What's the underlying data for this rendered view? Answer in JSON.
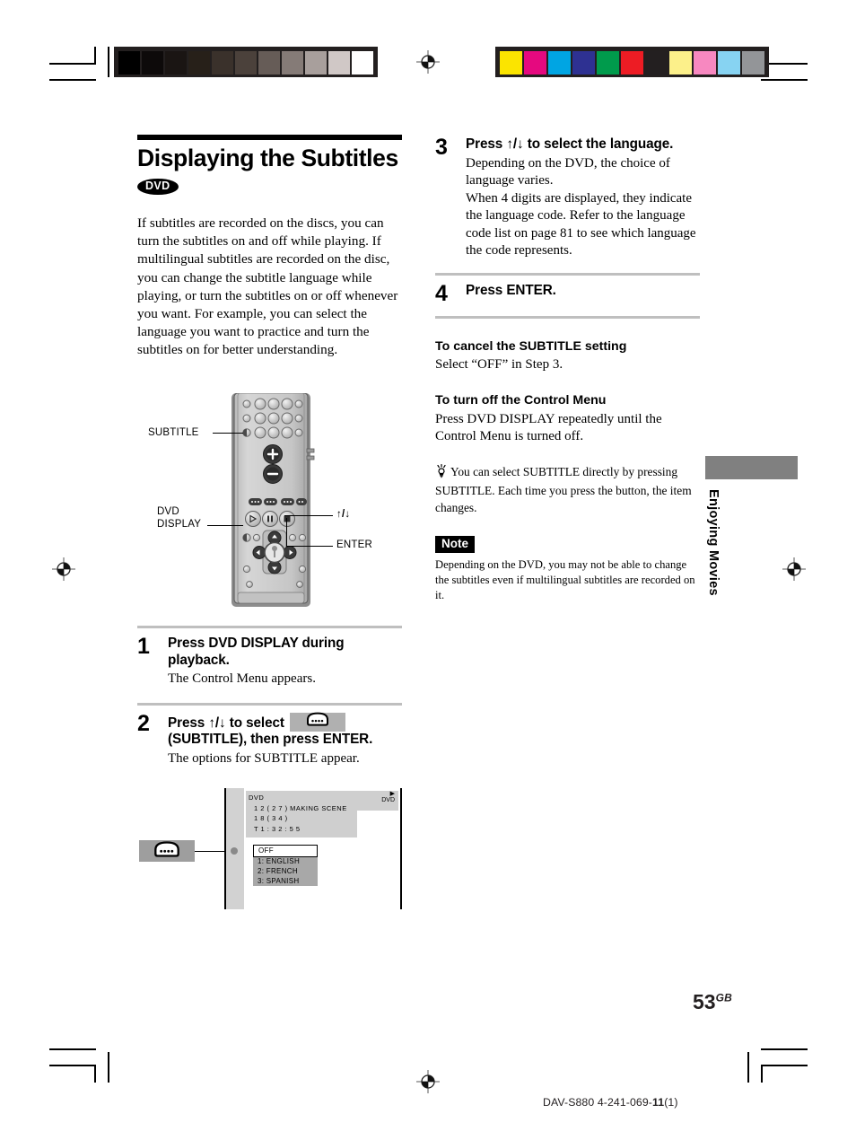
{
  "page": {
    "number": "53",
    "number_suffix": "GB",
    "model_line_prefix": "DAV-S880 4-241-069-",
    "model_line_bold": "11",
    "model_line_suffix": "(1)",
    "thumb_tab_label": "Enjoying Movies"
  },
  "colorbars": {
    "left_name": "grayscale-calibration-bar",
    "left_swatches": [
      "#000000",
      "#0d0a0a",
      "#1a1513",
      "#272019",
      "#3a312b",
      "#4b413b",
      "#665c57",
      "#857b77",
      "#a89f9c",
      "#d0c8c6",
      "#ffffff"
    ],
    "right_name": "color-calibration-bar",
    "right_swatches": [
      "#fbe400",
      "#e5097f",
      "#00a5e3",
      "#2e3192",
      "#009b4c",
      "#ed1c24",
      "#231f20",
      "#fcf08a",
      "#f788c0",
      "#87d3f2",
      "#939598"
    ]
  },
  "left_column": {
    "title": "Displaying the Subtitles",
    "badge": "DVD",
    "intro": "If subtitles are recorded on the discs, you can turn the subtitles on and off while playing. If multilingual subtitles are recorded on the disc, you can change the subtitle language while playing, or turn the subtitles on or off whenever you want. For example, you can select the language you want to practice and turn the subtitles on for better understanding.",
    "remote_callouts": {
      "subtitle": "SUBTITLE",
      "dvd_display_line1": "DVD",
      "dvd_display_line2": "DISPLAY",
      "updown": "↑/↓",
      "enter": "ENTER"
    },
    "steps": [
      {
        "num": "1",
        "head": "Press DVD DISPLAY during playback.",
        "sub": "The Control Menu appears."
      },
      {
        "num": "2",
        "head_part1": "Press ↑/↓ to select",
        "head_part2": "(SUBTITLE), then press ENTER.",
        "sub": "The options for SUBTITLE appear."
      }
    ]
  },
  "osd": {
    "chip_icon": "subtitle-icon",
    "disc_label": "DVD",
    "info_lines": [
      "DVD",
      "1 2 ( 2 7 ) MAKING SCENE",
      "1 8 ( 3 4 )",
      "T    1 : 3 2 : 5 5"
    ],
    "selected_option": "OFF",
    "options": [
      "1: ENGLISH",
      "2: FRENCH",
      "3: SPANISH"
    ]
  },
  "right_column": {
    "steps": [
      {
        "num": "3",
        "head": "Press ↑/↓ to select the language.",
        "sub": "Depending on the DVD, the choice of language varies.\nWhen 4 digits are displayed, they indicate the language code. Refer to the language code list on page 81 to see which language the code represents."
      },
      {
        "num": "4",
        "head": "Press ENTER.",
        "sub": ""
      }
    ],
    "cancel_heading": "To cancel the SUBTITLE setting",
    "cancel_text": "Select “OFF” in Step 3.",
    "turnoff_heading": "To turn off the Control Menu",
    "turnoff_text": "Press DVD DISPLAY repeatedly until the Control Menu is turned off.",
    "tip_text": "You can select SUBTITLE directly by pressing SUBTITLE. Each time you press the button, the item changes.",
    "note_badge": "Note",
    "note_text": "Depending on the DVD, you may not be able to change the subtitles even if multilingual subtitles are recorded on it."
  }
}
